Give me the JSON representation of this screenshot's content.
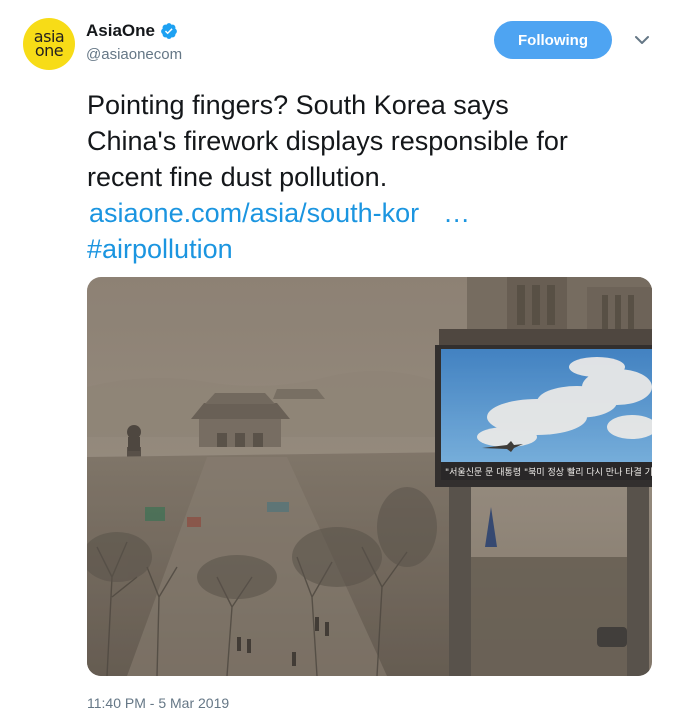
{
  "author": {
    "avatar_line1": "asia",
    "avatar_line2": "one",
    "name": "AsiaOne",
    "handle": "@asiaonecom",
    "verified_icon": "verified-badge-icon"
  },
  "follow_button": {
    "label": "Following"
  },
  "tweet": {
    "line1": "Pointing fingers? South Korea says",
    "line2": "China's firework displays responsible for",
    "line3": "recent fine dust pollution.",
    "link": "asiaone.com/asia/south-kor",
    "link_ellipsis": "…",
    "hashtag": "#airpollution"
  },
  "media": {
    "billboard_ticker": "\"서울신문 문 대통령 \"북미 정상 빨리 다시 만나 타결 기대"
  },
  "timestamp": "11:40 PM - 5 Mar 2019",
  "colors": {
    "accent": "#1b95e0",
    "follow_button_bg": "#4ea4f2",
    "avatar_bg": "#f7dc17",
    "secondary_text": "#657786"
  }
}
